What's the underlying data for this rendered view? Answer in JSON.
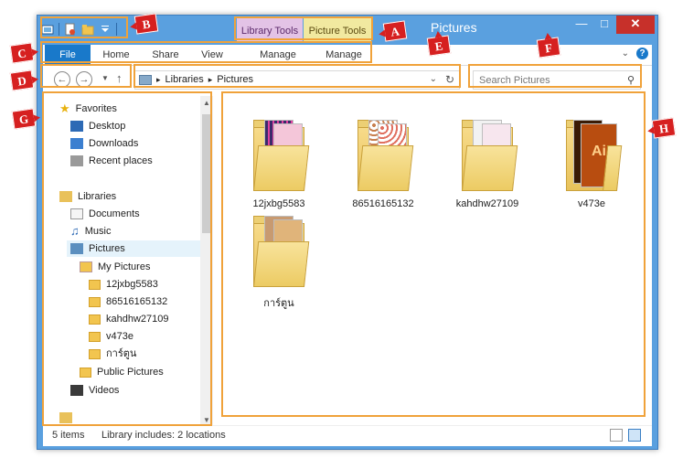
{
  "window": {
    "title": "Pictures"
  },
  "ribbon": {
    "context_tabs": [
      "Library Tools",
      "Picture Tools"
    ],
    "tabs": [
      "File",
      "Home",
      "Share",
      "View",
      "Manage",
      "Manage"
    ]
  },
  "address": {
    "crumbs": [
      "Libraries",
      "Pictures"
    ]
  },
  "search": {
    "placeholder": "Search Pictures"
  },
  "nav": {
    "items": [
      "Favorites",
      "Desktop",
      "Downloads",
      "Recent places",
      "Libraries",
      "Documents",
      "Music",
      "Pictures",
      "My Pictures",
      "12jxbg5583",
      "86516165132",
      "kahdhw27109",
      "v473e",
      "การ์ตูน",
      "Public Pictures",
      "Videos"
    ]
  },
  "content": {
    "folders": [
      "12jxbg5583",
      "86516165132",
      "kahdhw27109",
      "v473e",
      "การ์ตูน"
    ]
  },
  "status": {
    "count": "5 items",
    "info": "Library includes: 2 locations"
  },
  "annotations": {
    "labels": [
      "A",
      "B",
      "C",
      "D",
      "E",
      "F",
      "G",
      "H"
    ]
  }
}
